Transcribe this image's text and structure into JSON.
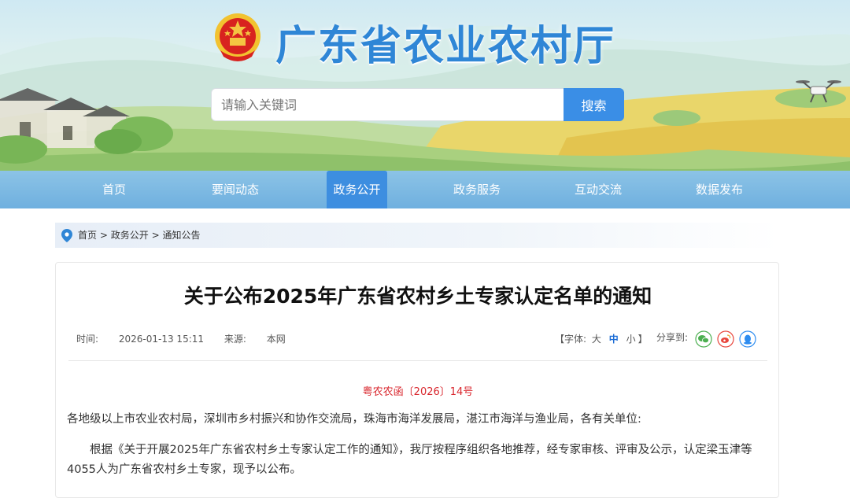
{
  "site": {
    "title": "广东省农业农村厅"
  },
  "search": {
    "placeholder": "请输入关键词",
    "button_label": "搜索"
  },
  "nav": {
    "items": [
      {
        "label": "首页"
      },
      {
        "label": "要闻动态"
      },
      {
        "label": "政务公开"
      },
      {
        "label": "政务服务"
      },
      {
        "label": "互动交流"
      },
      {
        "label": "数据发布"
      }
    ],
    "active": "政务公开"
  },
  "breadcrumb": {
    "home": "首页",
    "sep": ">",
    "level1": "政务公开",
    "level2": "通知公告"
  },
  "article": {
    "title": "关于公布2025年广东省农村乡土专家认定名单的通知",
    "time_label": "时间:",
    "time": "2026-01-13 15:11",
    "source_label": "来源:",
    "source": "本网",
    "fontsize": {
      "open": "【字体:",
      "large": "大",
      "medium": "中",
      "small": "小",
      "close": "】"
    },
    "share_label": "分享到:",
    "doc_number": "粤农农函〔2026〕14号",
    "paragraph1": "各地级以上市农业农村局，深圳市乡村振兴和协作交流局，珠海市海洋发展局，湛江市海洋与渔业局，各有关单位:",
    "paragraph2": "根据《关于开展2025年广东省农村乡土专家认定工作的通知》，我厅按程序组织各地推荐，经专家审核、评审及公示，认定梁玉津等4055人为广东省农村乡土专家，现予以公布。"
  },
  "colors": {
    "brand_blue": "#2f86d6",
    "nav_bg": "#7ab8e2",
    "nav_active": "#3d8ee0",
    "doc_number_red": "#d9272e",
    "share_wechat": "#4caf50",
    "share_weibo": "#e8453c",
    "share_qq": "#2d8cf0"
  },
  "icons": [
    "national-emblem-icon",
    "location-pin-icon",
    "wechat-icon",
    "weibo-icon",
    "qq-icon",
    "drone-icon"
  ]
}
